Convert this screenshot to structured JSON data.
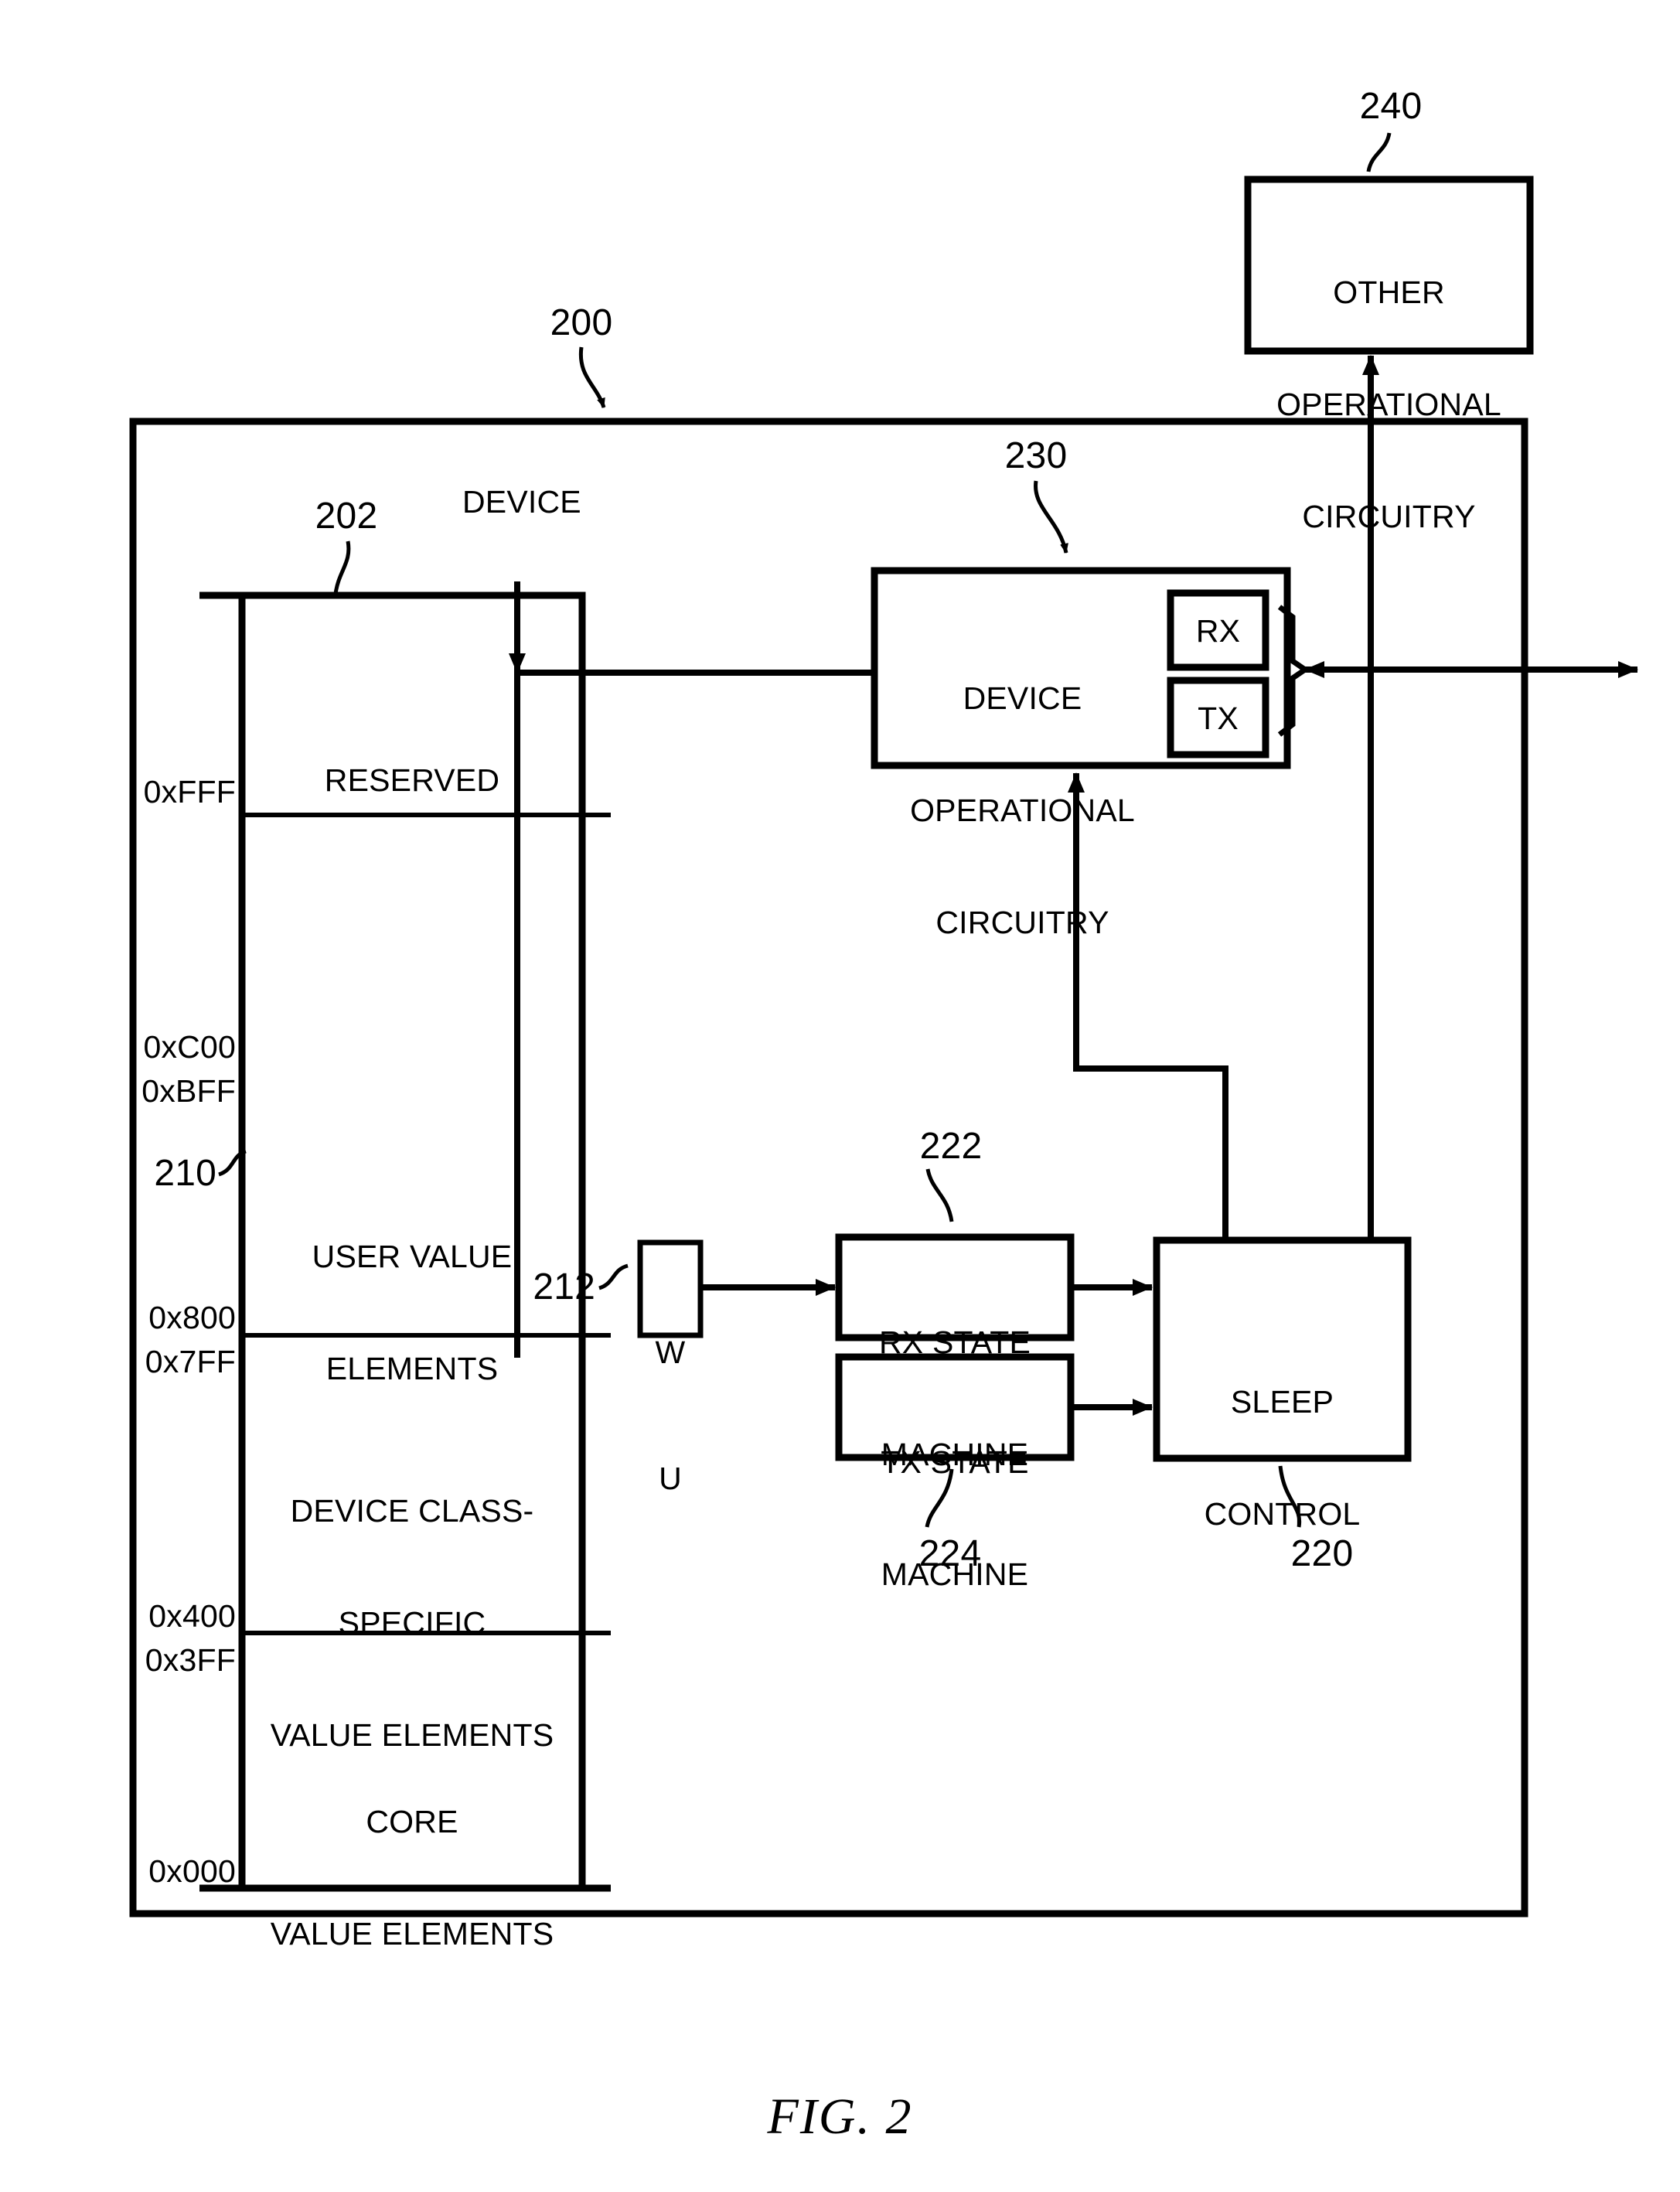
{
  "figure": {
    "caption": "FIG. 2",
    "device_label": "DEVICE"
  },
  "reference_numerals": {
    "device": "200",
    "memory_map": "202",
    "user_value_elements": "210",
    "wake_unit": "212",
    "sleep_control": "220",
    "rx_state_machine": "222",
    "tx_state_machine": "224",
    "device_operational_circuitry": "230",
    "other_operational_circuitry": "240"
  },
  "memory_map": {
    "regions": [
      {
        "name": "RESERVED",
        "lines": [
          "RESERVED"
        ]
      },
      {
        "name": "USER VALUE ELEMENTS",
        "lines": [
          "USER VALUE",
          "ELEMENTS"
        ]
      },
      {
        "name": "DEVICE CLASS-SPECIFIC VALUE ELEMENTS",
        "lines": [
          "DEVICE CLASS-",
          "SPECIFIC",
          "VALUE ELEMENTS"
        ]
      },
      {
        "name": "CORE VALUE ELEMENTS",
        "lines": [
          "CORE",
          "VALUE ELEMENTS"
        ]
      }
    ],
    "addresses": [
      {
        "value": "0xFFF"
      },
      {
        "value": "0xC00"
      },
      {
        "value": "0xBFF"
      },
      {
        "value": "0x800"
      },
      {
        "value": "0x7FF"
      },
      {
        "value": "0x400"
      },
      {
        "value": "0x3FF"
      },
      {
        "value": "0x000"
      }
    ]
  },
  "blocks": {
    "other_operational_circuitry": {
      "lines": [
        "OTHER",
        "OPERATIONAL",
        "CIRCUITRY"
      ]
    },
    "device_operational_circuitry": {
      "lines": [
        "DEVICE",
        "OPERATIONAL",
        "CIRCUITRY"
      ]
    },
    "rx_port": {
      "label": "RX"
    },
    "tx_port": {
      "label": "TX"
    },
    "rx_state_machine": {
      "lines": [
        "RX STATE",
        "MACHINE"
      ]
    },
    "tx_state_machine": {
      "lines": [
        "TX STATE",
        "MACHINE"
      ]
    },
    "sleep_control": {
      "lines": [
        "SLEEP",
        "CONTROL"
      ]
    },
    "wake_unit": {
      "lines": [
        "W",
        "U"
      ]
    }
  },
  "colors": {
    "ink": "#000000",
    "paper": "#ffffff"
  }
}
